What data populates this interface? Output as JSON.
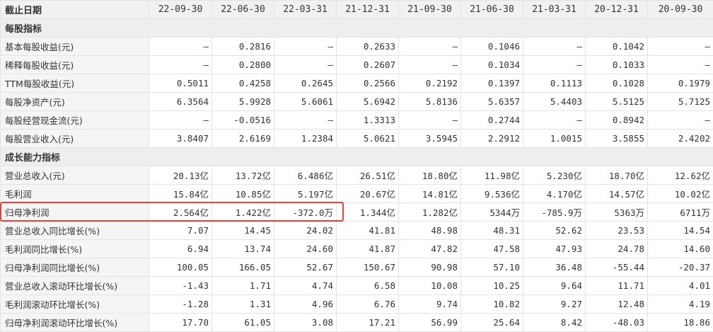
{
  "header": {
    "label": "截止日期",
    "dates": [
      "22-09-30",
      "22-06-30",
      "22-03-31",
      "21-12-31",
      "21-09-30",
      "21-06-30",
      "21-03-31",
      "20-12-31",
      "20-09-30"
    ]
  },
  "sections": [
    {
      "title": "每股指标",
      "rows": [
        {
          "label": "基本每股收益(元)",
          "values": [
            "—",
            "0.2816",
            "—",
            "0.2633",
            "—",
            "0.1046",
            "—",
            "0.1042",
            "—"
          ]
        },
        {
          "label": "稀释每股收益(元)",
          "values": [
            "—",
            "0.2800",
            "—",
            "0.2607",
            "—",
            "0.1034",
            "—",
            "0.1033",
            "—"
          ]
        },
        {
          "label": "TTM每股收益(元)",
          "values": [
            "0.5011",
            "0.4258",
            "0.2645",
            "0.2566",
            "0.2192",
            "0.1397",
            "0.1113",
            "0.1028",
            "0.1979"
          ]
        },
        {
          "label": "每股净资产(元)",
          "values": [
            "6.3564",
            "5.9928",
            "5.6061",
            "5.6942",
            "5.8136",
            "5.6357",
            "5.4403",
            "5.5125",
            "5.7125"
          ]
        },
        {
          "label": "每股经营现金流(元)",
          "values": [
            "—",
            "-0.0516",
            "—",
            "1.3313",
            "—",
            "0.2744",
            "—",
            "0.8942",
            "—"
          ]
        },
        {
          "label": "每股营业收入(元)",
          "values": [
            "3.8407",
            "2.6169",
            "1.2384",
            "5.0621",
            "3.5945",
            "2.2912",
            "1.0015",
            "3.5855",
            "2.4202"
          ]
        }
      ]
    },
    {
      "title": "成长能力指标",
      "rows": [
        {
          "label": "营业总收入(元)",
          "values": [
            "20.13亿",
            "13.72亿",
            "6.486亿",
            "26.51亿",
            "18.80亿",
            "11.98亿",
            "5.230亿",
            "18.70亿",
            "12.62亿"
          ]
        },
        {
          "label": "毛利润",
          "values": [
            "15.84亿",
            "10.85亿",
            "5.197亿",
            "20.67亿",
            "14.81亿",
            "9.536亿",
            "4.170亿",
            "14.57亿",
            "10.02亿"
          ]
        },
        {
          "label": "归母净利润",
          "values": [
            "2.564亿",
            "1.422亿",
            "-372.0万",
            "1.344亿",
            "1.282亿",
            "5344万",
            "-785.9万",
            "5363万",
            "6711万"
          ]
        },
        {
          "label": "营业总收入同比增长(%)",
          "values": [
            "7.07",
            "14.45",
            "24.02",
            "41.81",
            "48.98",
            "48.31",
            "52.62",
            "23.53",
            "14.54"
          ]
        },
        {
          "label": "毛利润同比增长(%)",
          "values": [
            "6.94",
            "13.74",
            "24.60",
            "41.87",
            "47.82",
            "47.58",
            "47.93",
            "24.78",
            "14.60"
          ]
        },
        {
          "label": "归母净利润同比增长(%)",
          "values": [
            "100.05",
            "166.05",
            "52.67",
            "150.67",
            "90.98",
            "57.10",
            "36.48",
            "-55.44",
            "-20.37"
          ]
        },
        {
          "label": "营业总收入滚动环比增长(%)",
          "values": [
            "-1.43",
            "1.71",
            "4.74",
            "6.58",
            "10.08",
            "10.25",
            "9.64",
            "11.71",
            "4.01"
          ]
        },
        {
          "label": "毛利润滚动环比增长(%)",
          "values": [
            "-1.28",
            "1.31",
            "4.96",
            "6.76",
            "9.74",
            "10.82",
            "9.27",
            "12.48",
            "4.19"
          ]
        },
        {
          "label": "归母净利润滚动环比增长(%)",
          "values": [
            "17.70",
            "61.05",
            "3.08",
            "17.21",
            "56.99",
            "25.64",
            "8.42",
            "-48.03",
            "18.86"
          ]
        }
      ]
    }
  ],
  "highlight_color": "#e8413a"
}
